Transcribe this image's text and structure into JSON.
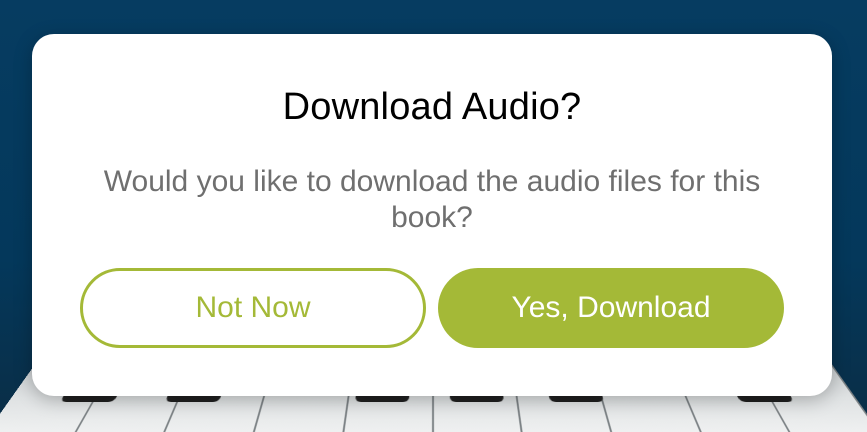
{
  "dialog": {
    "title": "Download Audio?",
    "message": "Would you like to download the audio files for this book?",
    "buttons": {
      "not_now": "Not Now",
      "yes_download": "Yes, Download"
    }
  },
  "colors": {
    "background": "#053a5e",
    "accent": "#a4b937",
    "dialog_bg": "#ffffff",
    "title_text": "#000000",
    "message_text": "#6f6f6f"
  }
}
